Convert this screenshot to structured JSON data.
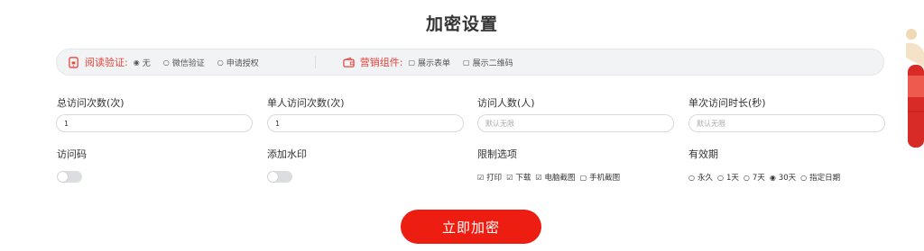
{
  "page_title": "加密设置",
  "settings_bar": {
    "read_verify": {
      "label": "阅读验证:",
      "options": [
        {
          "label": "无",
          "selected": true
        },
        {
          "label": "微信验证",
          "selected": false
        },
        {
          "label": "申请授权",
          "selected": false
        }
      ]
    },
    "marketing": {
      "label": "营销组件:",
      "options": [
        {
          "label": "展示表单",
          "checked": false
        },
        {
          "label": "展示二维码",
          "checked": false
        }
      ]
    }
  },
  "fields": {
    "total_visits": {
      "label": "总访问次数(次)",
      "value": "1",
      "placeholder": ""
    },
    "per_user_visits": {
      "label": "单人访问次数(次)",
      "value": "1",
      "placeholder": ""
    },
    "visitor_count": {
      "label": "访问人数(人)",
      "value": "",
      "placeholder": "默认无限"
    },
    "visit_duration": {
      "label": "单次访问时长(秒)",
      "value": "",
      "placeholder": "默认无限"
    }
  },
  "access_code": {
    "label": "访问码",
    "enabled": false
  },
  "watermark": {
    "label": "添加水印",
    "enabled": false
  },
  "restrictions": {
    "label": "限制选项",
    "options": [
      {
        "label": "打印",
        "checked": true
      },
      {
        "label": "下载",
        "checked": true
      },
      {
        "label": "电脑截图",
        "checked": true
      },
      {
        "label": "手机截图",
        "checked": false
      }
    ]
  },
  "validity": {
    "label": "有效期",
    "options": [
      {
        "label": "永久",
        "selected": false
      },
      {
        "label": "1天",
        "selected": false
      },
      {
        "label": "7天",
        "selected": false
      },
      {
        "label": "30天",
        "selected": true
      },
      {
        "label": "指定日期",
        "selected": false
      }
    ]
  },
  "submit_label": "立即加密",
  "colors": {
    "accent": "#ee1d12",
    "label_red": "#e8453c"
  }
}
